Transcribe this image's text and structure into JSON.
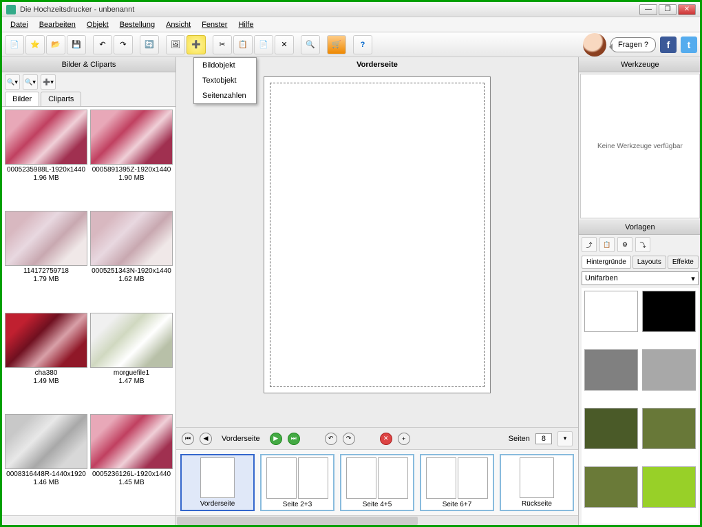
{
  "title": "Die Hochzeitsdrucker - unbenannt",
  "menu": [
    "Datei",
    "Bearbeiten",
    "Objekt",
    "Bestellung",
    "Ansicht",
    "Fenster",
    "Hilfe"
  ],
  "dropdown": [
    "Bildobjekt",
    "Textobjekt",
    "Seitenzahlen"
  ],
  "speech": "Fragen ?",
  "left": {
    "header": "Bilder & Cliparts",
    "tabs": [
      "Bilder",
      "Cliparts"
    ],
    "thumbs": [
      {
        "name": "0005235988L-1920x1440",
        "size": "1.96 MB",
        "cls": "img-roses-pink"
      },
      {
        "name": "0005891395Z-1920x1440",
        "size": "1.90 MB",
        "cls": "img-roses-pink"
      },
      {
        "name": "114172759718",
        "size": "1.79 MB",
        "cls": "img-mix"
      },
      {
        "name": "0005251343N-1920x1440",
        "size": "1.62 MB",
        "cls": "img-mix"
      },
      {
        "name": "cha380",
        "size": "1.49 MB",
        "cls": "img-roses-red"
      },
      {
        "name": "morguefile1",
        "size": "1.47 MB",
        "cls": "img-flowers-white"
      },
      {
        "name": "0008316448R-1440x1920",
        "size": "1.46 MB",
        "cls": "img-rings"
      },
      {
        "name": "0005236126L-1920x1440",
        "size": "1.45 MB",
        "cls": "img-roses-pink"
      }
    ]
  },
  "center": {
    "title": "Vorderseite",
    "page_label": "Vorderseite",
    "seiten_label": "Seiten",
    "seiten_count": "8",
    "pages": [
      "Vorderseite",
      "Seite 2+3",
      "Seite 4+5",
      "Seite 6+7",
      "Rückseite"
    ]
  },
  "right": {
    "tools_header": "Werkzeuge",
    "tools_empty": "Keine Werkzeuge verfügbar",
    "tmpl_header": "Vorlagen",
    "tmpl_tabs": [
      "Hintergründe",
      "Layouts",
      "Effekte"
    ],
    "combo": "Unifarben",
    "swatches": [
      "#ffffff",
      "#000000",
      "#808080",
      "#a8a8a8",
      "#4a5a28",
      "#687838",
      "#6a7a38",
      "#98d028"
    ]
  }
}
